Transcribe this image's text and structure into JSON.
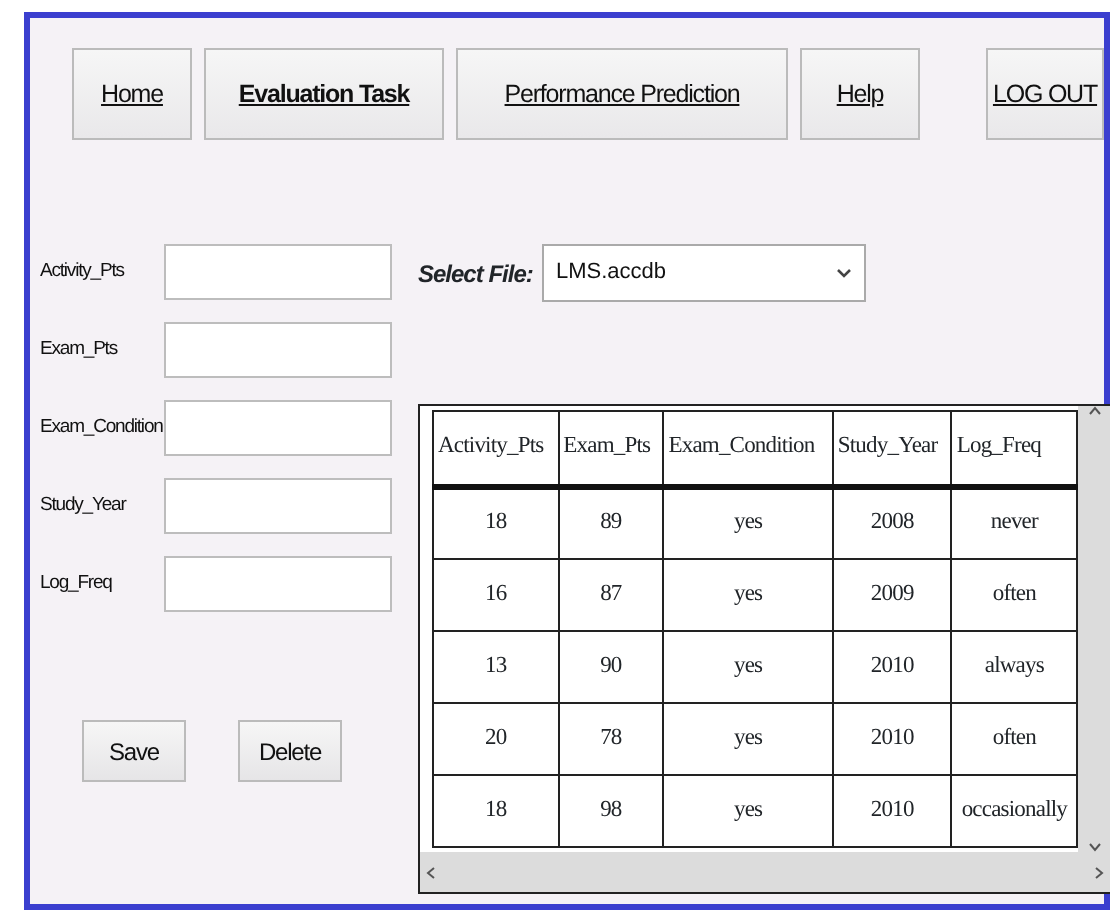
{
  "nav": [
    {
      "label": "Home",
      "selected": false
    },
    {
      "label": "Evaluation Task",
      "selected": true
    },
    {
      "label": "Performance Prediction",
      "selected": false
    },
    {
      "label": "Help",
      "selected": false
    },
    {
      "label": "LOG OUT",
      "selected": false
    }
  ],
  "form_fields": [
    {
      "label": "Activity_Pts"
    },
    {
      "label": "Exam_Pts"
    },
    {
      "label": "Exam_Condition"
    },
    {
      "label": "Study_Year"
    },
    {
      "label": "Log_Freq"
    }
  ],
  "buttons": [
    "Save",
    "Delete"
  ],
  "file_select": {
    "label": "Select File:",
    "value": "LMS.accdb"
  },
  "table": {
    "columns": [
      "Activity_Pts",
      "Exam_Pts",
      "Exam_Condition",
      "Study_Year",
      "Log_Freq"
    ],
    "rows": [
      [
        "18",
        "89",
        "yes",
        "2008",
        "never"
      ],
      [
        "16",
        "87",
        "yes",
        "2009",
        "often"
      ],
      [
        "13",
        "90",
        "yes",
        "2010",
        "always"
      ],
      [
        "20",
        "78",
        "yes",
        "2010",
        "often"
      ],
      [
        "18",
        "98",
        "yes",
        "2010",
        "occasionally"
      ]
    ]
  }
}
